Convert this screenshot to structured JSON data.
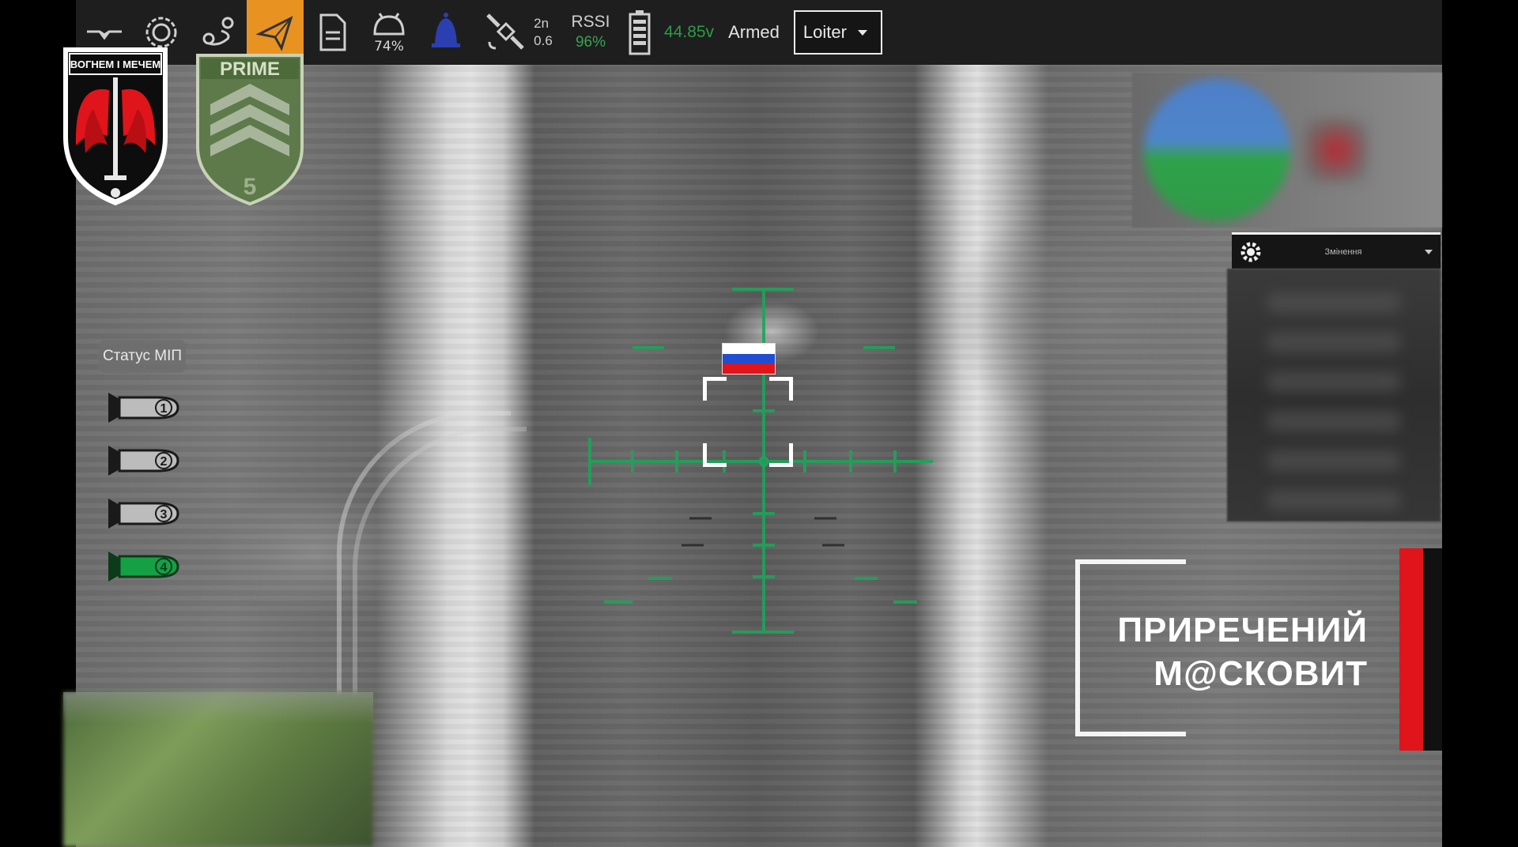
{
  "toolbar": {
    "battery_percent": "74%",
    "gps": {
      "satellites": "2n",
      "hdop": "0.6"
    },
    "rssi": {
      "label": "RSSI",
      "value": "96%"
    },
    "battery_voltage": "44.85v",
    "armed_label": "Armed",
    "mode": {
      "selected": "Loiter"
    }
  },
  "badges": {
    "unit_left": "ВОГНЕМ І МЕЧЕМ",
    "unit_right": "PRIME",
    "unit_right_number": "5"
  },
  "status": {
    "label": "Статус МІП",
    "bombs": [
      {
        "number": "1",
        "state": "used"
      },
      {
        "number": "2",
        "state": "used"
      },
      {
        "number": "3",
        "state": "used"
      },
      {
        "number": "4",
        "state": "ready"
      }
    ]
  },
  "right_panel": {
    "title": "Змінення"
  },
  "caption": {
    "line1": "ПРИРЕЧЕНИЙ",
    "line2": "М@СКОВИТ"
  },
  "colors": {
    "active_tool": "#e89222",
    "reticle": "#1fa35a",
    "ok_green": "#2f9a48",
    "accent_red": "#e0141b"
  }
}
